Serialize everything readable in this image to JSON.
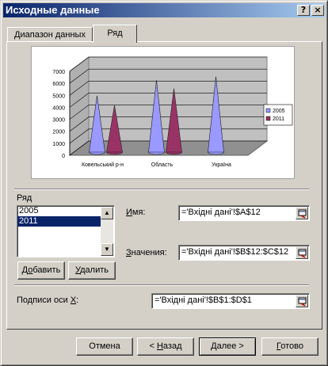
{
  "window": {
    "title": "Исходные данные",
    "help_label": "?",
    "close_label": "×"
  },
  "tabs": [
    {
      "label": "Диапазон данных",
      "active": false
    },
    {
      "label": "Ряд",
      "active": true
    }
  ],
  "chart_data": {
    "type": "bar",
    "bar_shape": "3d-cone",
    "categories": [
      "Ковельський р-н",
      "Область",
      "Україна"
    ],
    "series": [
      {
        "name": "2005",
        "color": "#9999ff",
        "values": [
          4700,
          6000,
          6300
        ]
      },
      {
        "name": "2011",
        "color": "#993366",
        "values": [
          3900,
          5300,
          0
        ]
      }
    ],
    "ylim": [
      0,
      7000
    ],
    "yticks": [
      "0",
      "1000",
      "2000",
      "3000",
      "4000",
      "5000",
      "6000",
      "7000"
    ],
    "legend_position": "right",
    "grid": true
  },
  "series_panel": {
    "group_label": "Ряд",
    "list": [
      {
        "label": "2005",
        "selected": false
      },
      {
        "label": "2011",
        "selected": true
      }
    ],
    "add_prefix": "Д",
    "add_accel": "о",
    "add_rest": "бавить",
    "remove_prefix": "",
    "remove_accel": "У",
    "remove_rest": "далить",
    "name_accel": "И",
    "name_rest": "мя:",
    "name_value": "='Вхідні дані'!$A$12",
    "values_accel": "З",
    "values_rest": "начения:",
    "values_value": "='Вхідні дані'!$B$12:$C$12"
  },
  "x_axis": {
    "label_prefix": "Подписи оси ",
    "label_accel": "X",
    "label_suffix": ":",
    "value": "='Вхідні дані'!$B$1:$D$1"
  },
  "buttons": {
    "cancel": "Отмена",
    "back_prefix": "< ",
    "back_accel": "Н",
    "back_rest": "азад",
    "next_accel": "Д",
    "next_rest": "алее >",
    "finish_accel": "Г",
    "finish_rest": "отово"
  }
}
